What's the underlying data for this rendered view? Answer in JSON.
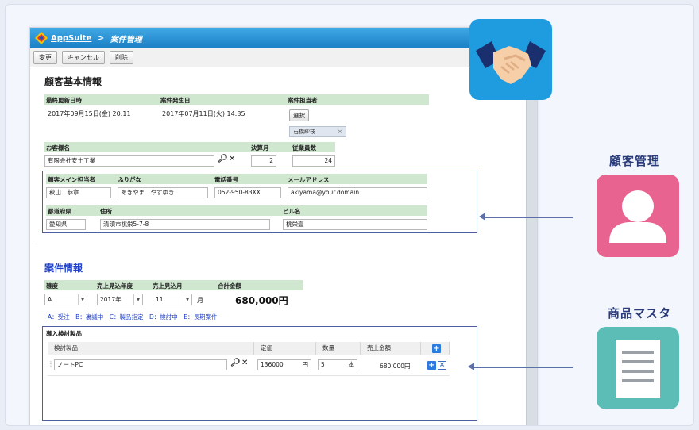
{
  "app": {
    "name": "AppSuite",
    "separator": " > ",
    "page": "案件管理"
  },
  "toolbar": {
    "change": "変更",
    "cancel": "キャンセル",
    "delete": "削除"
  },
  "customer": {
    "heading": "顧客基本情報",
    "last_updated_label": "最終更新日時",
    "last_updated": "2017年09月15日(金) 20:11",
    "occurred_label": "案件発生日",
    "occurred": "2017年07月11日(火) 14:35",
    "owner_label": "案件担当者",
    "select_button": "選択",
    "owner_tag": "石橋紗枝",
    "owner_tag_close": "×",
    "name_label": "お客様名",
    "name": "有限会社安土工業",
    "closing_label": "決算月",
    "closing": "2",
    "employees_label": "従業員数",
    "employees": "24",
    "contact_label": "顧客メイン担当者",
    "contact": "秋山　恭章",
    "furigana_label": "ふりがな",
    "furigana": "あきやま　やすゆき",
    "phone_label": "電話番号",
    "phone": "052-950-83XX",
    "email_label": "メールアドレス",
    "email": "akiyama@your.domain",
    "pref_label": "都道府県",
    "pref": "愛知県",
    "address_label": "住所",
    "address": "清須市桃栄5-7-8",
    "building_label": "ビル名",
    "building": "桃栄壹"
  },
  "deal": {
    "heading": "案件情報",
    "rank_label": "確度",
    "rank": "A",
    "year_label": "売上見込年度",
    "year": "2017年",
    "month_label": "売上見込月",
    "month": "11",
    "month_unit": "月",
    "total_label": "合計金額",
    "total": "680,000円",
    "legend": "A：受注　B：裏議中　C：製品指定　D：検討中　E：長期案件",
    "products_label": "導入検討製品",
    "columns": [
      "検討製品",
      "定価",
      "数量",
      "売上金額"
    ],
    "row": {
      "product": "ノートPC",
      "price": "136000",
      "price_unit": "円",
      "qty": "5",
      "qty_unit": "本",
      "amount": "680,000円"
    }
  },
  "right": {
    "customer_mgmt": "顧客管理",
    "product_master": "商品マスタ"
  },
  "colors": {
    "accent": "#1d3fc9",
    "pink": "#e8638f",
    "teal": "#5bbdb6",
    "blue_tile": "#1f9be0"
  },
  "icons": {
    "search": "search-icon",
    "clear": "close-icon",
    "handshake": "handshake-icon",
    "person": "person-icon",
    "document": "document-icon"
  }
}
